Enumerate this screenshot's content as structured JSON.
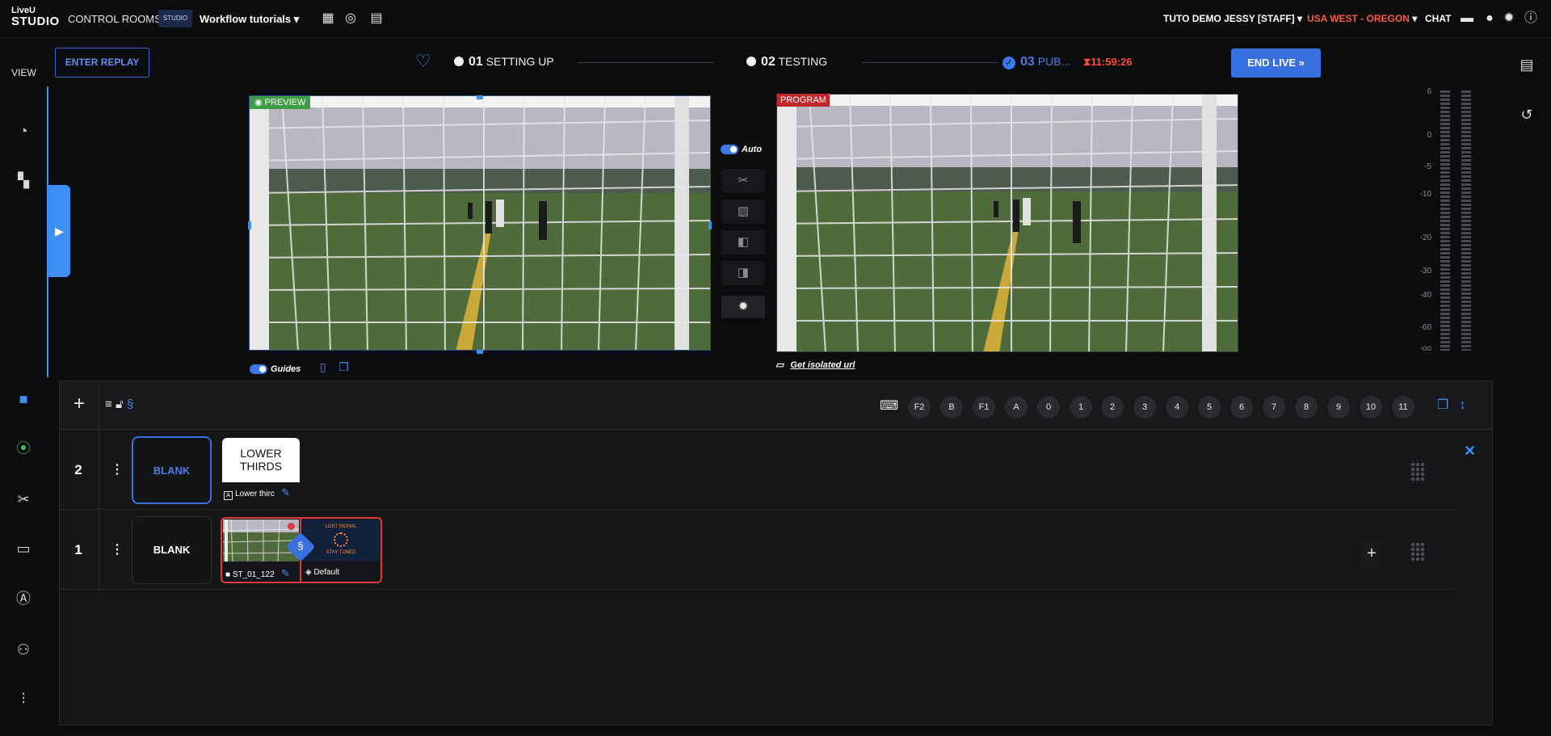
{
  "header": {
    "logo_line1": "LiveU",
    "logo_line2": "STUDIO",
    "control_rooms": "CONTROL ROOMS",
    "room_thumb": "STUDIO",
    "workflow": "Workflow tutorials",
    "account": "TUTO DEMO JESSY [STAFF]",
    "region": "USA WEST - OREGON",
    "chat": "CHAT"
  },
  "sidebar": {
    "view_label": "VIEW",
    "items": [
      "dashboard",
      "layouts",
      "sources",
      "outputs",
      "tools",
      "messages",
      "text",
      "guests",
      "settings"
    ]
  },
  "workflow": {
    "enter_replay": "ENTER REPLAY",
    "steps": [
      {
        "num": "01",
        "label": "SETTING UP"
      },
      {
        "num": "02",
        "label": "TESTING"
      },
      {
        "num": "03",
        "label": "PUB..."
      }
    ],
    "timer": "11:59:26",
    "end_live": "END LIVE"
  },
  "preview": {
    "tag": "PREVIEW"
  },
  "program": {
    "tag": "PROGRAM"
  },
  "transitions": {
    "auto_label": "Auto"
  },
  "under": {
    "guides": "Guides",
    "isolated_url": "Get isolated url"
  },
  "vu": {
    "labels": [
      "6",
      "0",
      "-5",
      "-10",
      "-20",
      "-30",
      "-40",
      "-60",
      "-oo"
    ]
  },
  "rundown": {
    "keys": [
      "F2",
      "B",
      "F1",
      "A",
      "0",
      "1",
      "2",
      "3",
      "4",
      "5",
      "6",
      "7",
      "8",
      "9",
      "10",
      "11"
    ],
    "rows": [
      {
        "num": "2",
        "blank": "BLANK",
        "card_line1": "LOWER",
        "card_line2": "THIRDS",
        "caption": "Lower thirc"
      },
      {
        "num": "1",
        "blank": "BLANK",
        "source_caption": "ST_01_122",
        "graphic_top": "LOST SIGNAL",
        "graphic_bottom": "STAY TUNED",
        "default_caption": "Default"
      }
    ]
  },
  "colors": {
    "accent": "#3d8ef5",
    "live": "#e03a3a",
    "region": "#ff5a3c",
    "preview": "#3f9d46",
    "program": "#c1272d"
  }
}
